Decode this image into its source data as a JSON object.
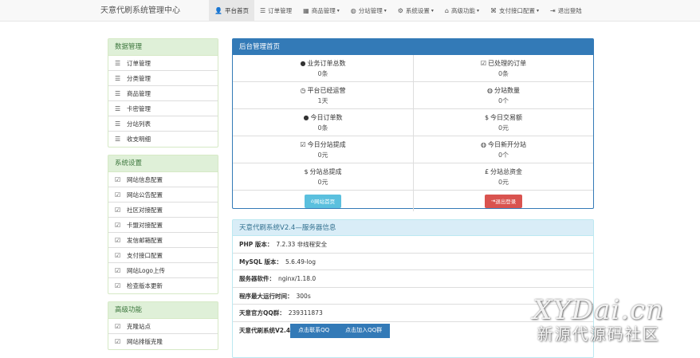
{
  "brand": "天意代刷系统管理中心",
  "nav": [
    {
      "icon": "user-icon",
      "glyph": "👤",
      "label": "平台首页",
      "dropdown": false,
      "active": true
    },
    {
      "icon": "list-icon",
      "glyph": "☰",
      "label": "订单管理",
      "dropdown": false,
      "active": false
    },
    {
      "icon": "grid-icon",
      "glyph": "▦",
      "label": "商品管理",
      "dropdown": true,
      "active": false
    },
    {
      "icon": "globe-icon",
      "glyph": "◍",
      "label": "分站管理",
      "dropdown": true,
      "active": false
    },
    {
      "icon": "gear-icon",
      "glyph": "⚙",
      "label": "系统设置",
      "dropdown": true,
      "active": false
    },
    {
      "icon": "bank-icon",
      "glyph": "⌂",
      "label": "高级功能",
      "dropdown": true,
      "active": false
    },
    {
      "icon": "tag-icon",
      "glyph": "⌘",
      "label": "支付接口配置",
      "dropdown": true,
      "active": false
    },
    {
      "icon": "logout-icon",
      "glyph": "⇥",
      "label": "退出登陆",
      "dropdown": false,
      "active": false
    }
  ],
  "sidebar": {
    "data_mgmt": {
      "title": "数据管理",
      "items": [
        "订单管理",
        "分类管理",
        "商品管理",
        "卡密管理",
        "分站列表",
        "收支明细"
      ]
    },
    "system_settings": {
      "title": "系统设置",
      "items": [
        "网站信息配置",
        "网站公告配置",
        "社区对接配置",
        "卡盟对接配置",
        "发信邮箱配置",
        "支付接口配置",
        "网站Logo上传",
        "检查版本更新"
      ]
    },
    "advanced": {
      "title": "高级功能",
      "items": [
        "克隆站点",
        "网站排版克隆"
      ]
    }
  },
  "dashboard": {
    "title": "后台管理首页",
    "stats": [
      {
        "icon": "drop-icon",
        "glyph": "●",
        "label": "业务订单总数",
        "value": "0条"
      },
      {
        "icon": "check-square-icon",
        "glyph": "☑",
        "label": "已处理的订单",
        "value": "0条"
      },
      {
        "icon": "clock-icon",
        "glyph": "◷",
        "label": "平台已经运营",
        "value": "1天"
      },
      {
        "icon": "globe-icon",
        "glyph": "◍",
        "label": "分站数量",
        "value": "0个"
      },
      {
        "icon": "drop-icon",
        "glyph": "●",
        "label": "今日订单数",
        "value": "0条"
      },
      {
        "icon": "dollar-icon",
        "glyph": "$",
        "label": "今日交易额",
        "value": "0元"
      },
      {
        "icon": "check-square-icon",
        "glyph": "☑",
        "label": "今日分站提成",
        "value": "0元"
      },
      {
        "icon": "globe-icon",
        "glyph": "◍",
        "label": "今日新开分站",
        "value": "0个"
      },
      {
        "icon": "dollar-icon",
        "glyph": "$",
        "label": "分站总提成",
        "value": "0元"
      },
      {
        "icon": "pound-icon",
        "glyph": "£",
        "label": "分站总资金",
        "value": "0元"
      }
    ],
    "home_button": "网站首页",
    "logout_button": "退出登录"
  },
  "server_info": {
    "title": "天意代刷系统V2.4—服务器信息",
    "rows": [
      {
        "label": "PHP 版本：",
        "value": "7.2.33 非线程安全"
      },
      {
        "label": "MySQL 版本：",
        "value": "5.6.49-log"
      },
      {
        "label": "服务器软件：",
        "value": "nginx/1.18.0"
      },
      {
        "label": "程序最大运行时间：",
        "value": "300s"
      },
      {
        "label": "天意官方QQ群：",
        "value": "239311873"
      }
    ],
    "footer_label": "天意代刷系统V2.4",
    "contact_qq_button": "点击联系QQ",
    "join_group_button": "点击加入QQ群"
  },
  "watermark": {
    "line1": "XYDai.cn",
    "line2": "新源代源码社区"
  },
  "colors": {
    "primary": "#337ab7",
    "success_bg": "#dff0d8",
    "info_bg": "#d9edf7",
    "btn_info": "#5bc0de",
    "btn_danger": "#d9534f"
  }
}
